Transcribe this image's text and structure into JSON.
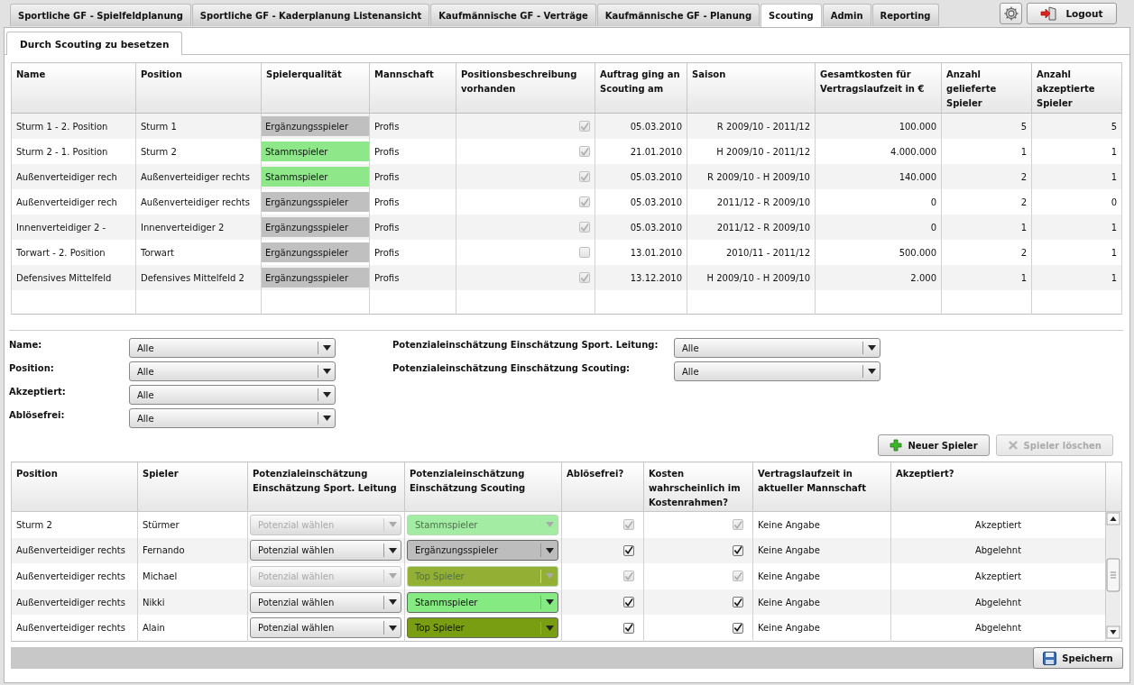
{
  "top_tabs": [
    {
      "label": "Sportliche GF - Spielfeldplanung",
      "selected": false
    },
    {
      "label": "Sportliche GF - Kaderplanung Listenansicht",
      "selected": false
    },
    {
      "label": "Kaufmännische GF - Verträge",
      "selected": false
    },
    {
      "label": "Kaufmännische GF - Planung",
      "selected": false
    },
    {
      "label": "Scouting",
      "selected": true
    },
    {
      "label": "Admin",
      "selected": false
    },
    {
      "label": "Reporting",
      "selected": false
    }
  ],
  "logout_button": "Logout",
  "sub_tabs": [
    {
      "label": "Durch Scouting zu besetzen",
      "selected": true
    }
  ],
  "positions_table": {
    "columns": [
      "Name",
      "Position",
      "Spielerqualität",
      "Mannschaft",
      "Positionsbeschreibung vorhanden",
      "Auftrag ging an Scouting am",
      "Saison",
      "Gesamtkosten für Vertragslaufzeit in €",
      "Anzahl gelieferte Spieler",
      "Anzahl akzeptierte Spieler"
    ],
    "rows": [
      {
        "name": "Sturm 1 - 2. Position",
        "position": "Sturm 1",
        "quality": {
          "text": "Ergänzungsspieler",
          "color": "#c0c0c0"
        },
        "team": "Profis",
        "description_available": true,
        "date": "05.03.2010",
        "season": "R 2009/10 -  2011/12",
        "total_cost": "100.000",
        "delivered": "5",
        "accepted": "5"
      },
      {
        "name": "Sturm 2 - 1. Position",
        "position": "Sturm 2",
        "quality": {
          "text": "Stammspieler",
          "color": "#8ee88a"
        },
        "team": "Profis",
        "description_available": true,
        "date": "21.01.2010",
        "season": "H 2009/10 -  2011/12",
        "total_cost": "4.000.000",
        "delivered": "1",
        "accepted": "1"
      },
      {
        "name": "Außenverteidiger rech",
        "position": "Außenverteidiger rechts",
        "quality": {
          "text": "Stammspieler",
          "color": "#8ee88a"
        },
        "team": "Profis",
        "description_available": true,
        "date": "05.03.2010",
        "season": "R 2009/10 - H 2009/10",
        "total_cost": "140.000",
        "delivered": "2",
        "accepted": "1"
      },
      {
        "name": "Außenverteidiger rech",
        "position": "Außenverteidiger rechts",
        "quality": {
          "text": "Ergänzungsspieler",
          "color": "#c0c0c0"
        },
        "team": "Profis",
        "description_available": true,
        "date": "05.03.2010",
        "season": "2011/12 - R 2009/10",
        "total_cost": "0",
        "delivered": "2",
        "accepted": "0"
      },
      {
        "name": "Innenverteidiger 2 -",
        "position": "Innenverteidiger 2",
        "quality": {
          "text": "Ergänzungsspieler",
          "color": "#c0c0c0"
        },
        "team": "Profis",
        "description_available": true,
        "date": "05.03.2010",
        "season": "2011/12 - R 2009/10",
        "total_cost": "0",
        "delivered": "1",
        "accepted": "1"
      },
      {
        "name": "Torwart - 2. Position",
        "position": "Torwart",
        "quality": {
          "text": "Ergänzungsspieler",
          "color": "#c0c0c0"
        },
        "team": "Profis",
        "description_available": false,
        "date": "13.01.2010",
        "season": "2010/11 -  2011/12",
        "total_cost": "500.000",
        "delivered": "2",
        "accepted": "1"
      },
      {
        "name": "Defensives Mittelfeld",
        "position": "Defensives Mittelfeld 2",
        "quality": {
          "text": "Ergänzungsspieler",
          "color": "#c0c0c0"
        },
        "team": "Profis",
        "description_available": true,
        "date": "13.12.2010",
        "season": "H 2009/10 - H 2009/10",
        "total_cost": "2.000",
        "delivered": "1",
        "accepted": "1"
      }
    ]
  },
  "filters": {
    "left": [
      {
        "label": "Name:",
        "value": "Alle"
      },
      {
        "label": "Position:",
        "value": "Alle"
      },
      {
        "label": "Akzeptiert:",
        "value": "Alle"
      },
      {
        "label": "Ablösefrei:",
        "value": "Alle"
      }
    ],
    "right": [
      {
        "label": "Potenzialeinschätzung Einschätzung Sport. Leitung:",
        "value": "Alle"
      },
      {
        "label": "Potenzialeinschätzung Einschätzung Scouting:",
        "value": "Alle"
      }
    ]
  },
  "actions": [
    {
      "label": "Neuer Spieler",
      "kind": "add",
      "disabled": false
    },
    {
      "label": "Spieler löschen",
      "kind": "delete",
      "disabled": true
    }
  ],
  "players_table": {
    "columns": [
      "Position",
      "Spieler",
      "Potenzialeinschätzung Einschätzung Sport. Leitung",
      "Potenzialeinschätzung Einschätzung Scouting",
      "Ablösefrei?",
      "Kosten wahrscheinlich im Kostenrahmen?",
      "Vertragslaufzeit in aktueller Mannschaft",
      "Akzeptiert?"
    ],
    "rows": [
      {
        "position": "Sturm 2",
        "player": "Stürmer",
        "disabled": true,
        "sport_assessment": "Potenzial wählen",
        "scouting_assessment": {
          "text": "Stammspieler",
          "color": "#a3eca3"
        },
        "transfer_free": true,
        "cost_in_budget": true,
        "contract_term": "Keine Angabe",
        "accepted": "Akzeptiert"
      },
      {
        "position": "Außenverteidiger rechts",
        "player": "Fernando",
        "disabled": false,
        "sport_assessment": "Potenzial wählen",
        "scouting_assessment": {
          "text": "Ergänzungsspieler",
          "color": "#bdbdbd"
        },
        "transfer_free": true,
        "cost_in_budget": true,
        "contract_term": "Keine Angabe",
        "accepted": "Abgelehnt"
      },
      {
        "position": "Außenverteidiger rechts",
        "player": "Michael",
        "disabled": true,
        "sport_assessment": "Potenzial wählen",
        "scouting_assessment": {
          "text": "Top Spieler",
          "color": "#93b034"
        },
        "transfer_free": true,
        "cost_in_budget": true,
        "contract_term": "Keine Angabe",
        "accepted": "Akzeptiert"
      },
      {
        "position": "Außenverteidiger rechts",
        "player": "Nikki",
        "disabled": false,
        "sport_assessment": "Potenzial wählen",
        "scouting_assessment": {
          "text": "Stammspieler",
          "color": "#86ea82"
        },
        "transfer_free": true,
        "cost_in_budget": true,
        "contract_term": "Keine Angabe",
        "accepted": "Abgelehnt"
      },
      {
        "position": "Außenverteidiger rechts",
        "player": "Alain",
        "disabled": false,
        "sport_assessment": "Potenzial wählen",
        "scouting_assessment": {
          "text": "Top Spieler",
          "color": "#7a9e12"
        },
        "transfer_free": true,
        "cost_in_budget": true,
        "contract_term": "Keine Angabe",
        "accepted": "Abgelehnt"
      }
    ]
  },
  "save_button": "Speichern"
}
